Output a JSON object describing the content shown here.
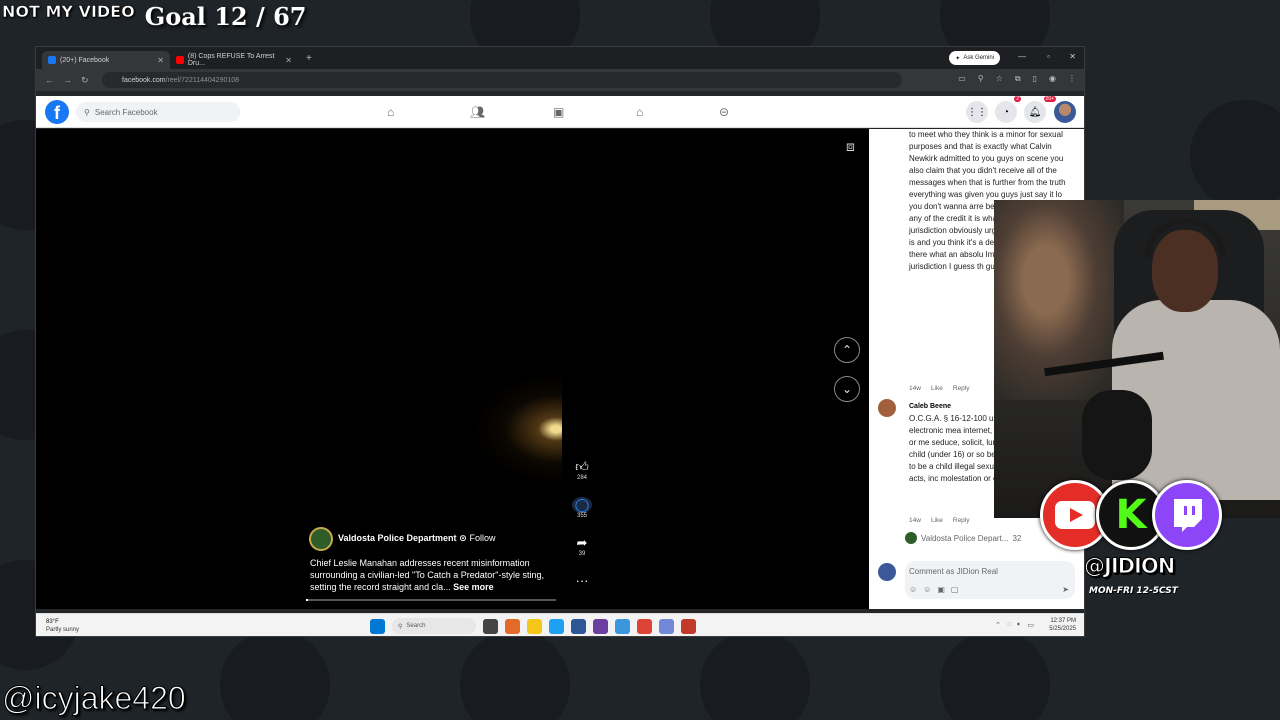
{
  "overlay": {
    "not_my_video": "NOT MY VIDEO",
    "goal": "Goal 12 / 67",
    "handle": "@icyjake420"
  },
  "browser": {
    "tabs": [
      {
        "label": "(20+) Facebook",
        "favicon_color": "#1877f2"
      },
      {
        "label": "(8) Cops REFUSE To Arrest Dru...",
        "favicon_color": "#ff0000"
      }
    ],
    "ask_gemini": "Ask Gemini",
    "url_domain": "facebook.com",
    "url_path": "/reel/722114404290108"
  },
  "facebook": {
    "search_placeholder": "Search Facebook",
    "messenger_badge": "2",
    "notif_badge": "20+"
  },
  "reel": {
    "page_name": "Valdosta Police Department",
    "follow_label": "· Follow",
    "caption": "Chief Leslie Manahan addresses recent misinformation surrounding a civilian-led \"To Catch a Predator\"-style sting, setting the record straight and cla...",
    "see_more": "See more",
    "likes": "284",
    "comments_count": "355",
    "shares": "39",
    "more": "···"
  },
  "comments": {
    "first_text": "to meet who they think is a minor for sexual purposes and that is exactly what Calvin Newkirk admitted to you guys on scene you also claim that you didn't receive all of the messages when that is further from the truth everything was given you guys just say it lo you don't wanna arre because you guys are any of the credit it is what he doesn't live i jurisdiction obviously urges to travel to whe is and you think it's a department that he d there what an absolu Imagine if it was a re jurisdiction I guess th guys are waiting for it",
    "first_meta": [
      "14w",
      "Like",
      "Reply"
    ],
    "second_name": "Caleb Beene",
    "second_text": "O.C.G.A. § 16-12-100 using electronic mea internet, email, or me seduce, solicit, lure, c child (under 16) or so believed to be a child illegal sexual acts, inc molestation or entice",
    "second_meta": [
      "14w",
      "Like",
      "Reply"
    ],
    "reply_by": "Valdosta Police Depart...",
    "reply_count": "32",
    "comment_placeholder": "Comment as JIDion Real"
  },
  "taskbar": {
    "weather_temp": "83°F",
    "weather_desc": "Partly sunny",
    "search_label": "Search",
    "time": "12:37 PM",
    "date": "5/25/2025"
  },
  "streamer": {
    "handle": "@JIDION",
    "schedule": "MON-FRI 12-5CST",
    "kick_letter": "K"
  },
  "colors": {
    "facebook_blue": "#1877f2",
    "youtube_red": "#e52d27",
    "kick_green": "#53fc18",
    "twitch_purple": "#8c45f7"
  }
}
